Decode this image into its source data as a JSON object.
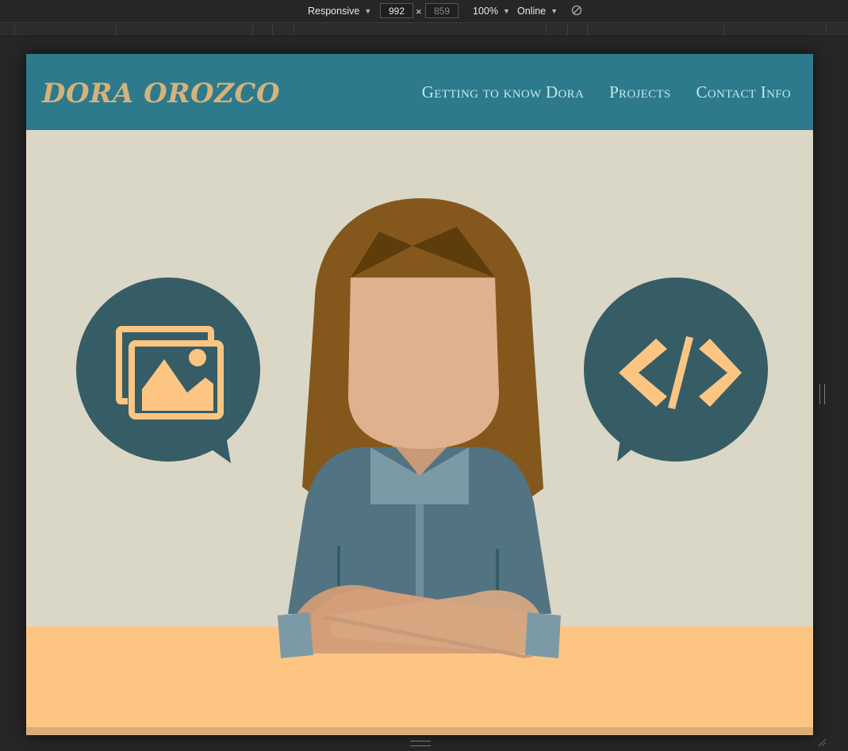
{
  "devtools": {
    "device_mode": "Responsive",
    "width": "992",
    "height": "859",
    "zoom": "100%",
    "throttling": "Online"
  },
  "site": {
    "logo": "DORA OROZCO",
    "nav": [
      {
        "label": "Getting to know Dora"
      },
      {
        "label": "Projects"
      },
      {
        "label": "Contact Info"
      }
    ]
  },
  "colors": {
    "header_bg": "#2c7a8c",
    "logo": "#d6b27a",
    "nav_link": "#c5e7ef",
    "wall": "#dad7c7",
    "desk": "#fcc582",
    "bubble": "#365d66",
    "icon_accent": "#fcc582",
    "hair": "#84581c",
    "skin": "#e0b18f",
    "shirt": "#527382"
  },
  "icons": {
    "left_bubble": "image-gallery-icon",
    "right_bubble": "code-icon"
  }
}
